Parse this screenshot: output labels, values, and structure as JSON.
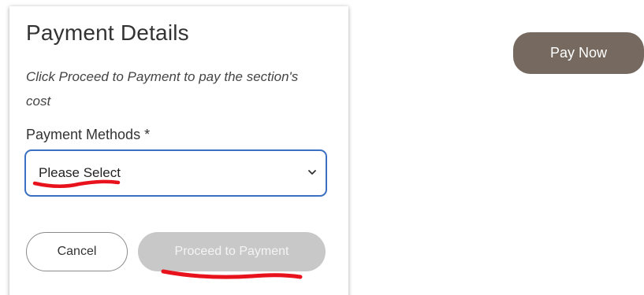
{
  "payment_card": {
    "title": "Payment Details",
    "instructions": "Click Proceed to Payment to pay the section's cost",
    "methods_label": "Payment Methods *",
    "methods_selected": "Please Select",
    "cancel_label": "Cancel",
    "proceed_label": "Proceed to Payment"
  },
  "pay_now_label": "Pay Now",
  "colors": {
    "select_border": "#3a6fc4",
    "proceed_disabled": "#c8c8c8",
    "pay_now_bg": "#76695f",
    "annotation": "#e8121c"
  },
  "icons": {
    "select_chevron": "chevron-down-icon"
  }
}
